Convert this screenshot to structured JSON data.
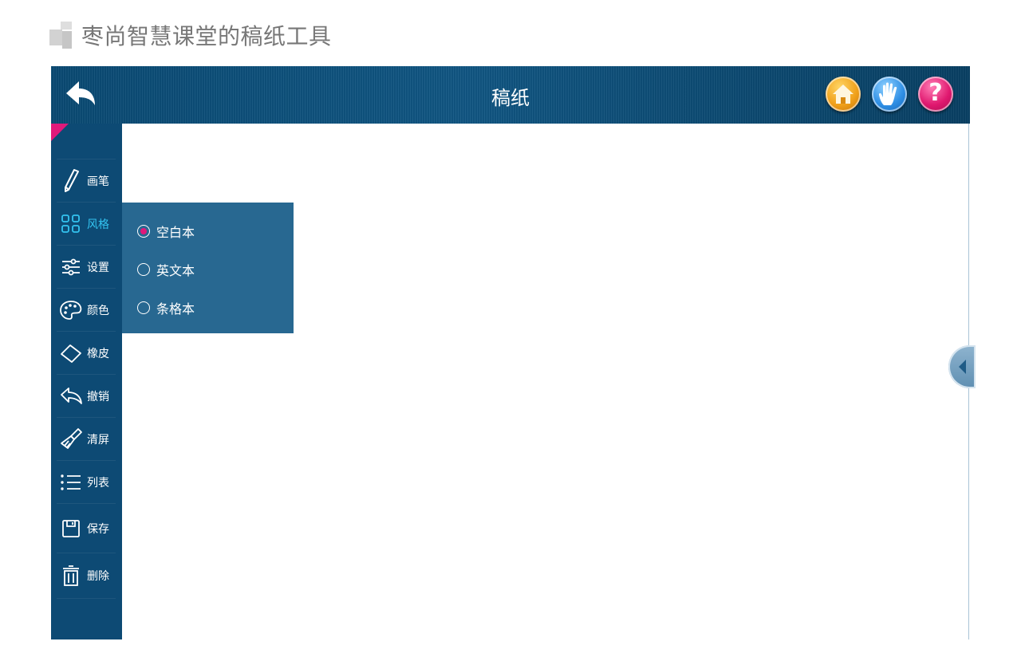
{
  "page": {
    "heading": "枣尚智慧课堂的稿纸工具"
  },
  "topbar": {
    "title": "稿纸",
    "back_icon": "back-arrow-icon",
    "home_icon": "home-icon",
    "hand_icon": "hand-icon",
    "help_icon": "question-mark-icon",
    "help_glyph": "?"
  },
  "sidebar": {
    "items": [
      {
        "label": "画笔",
        "icon": "pen-icon"
      },
      {
        "label": "风格",
        "icon": "grid-icon",
        "active": true
      },
      {
        "label": "设置",
        "icon": "sliders-icon"
      },
      {
        "label": "颜色",
        "icon": "palette-icon"
      },
      {
        "label": "橡皮",
        "icon": "eraser-icon"
      },
      {
        "label": "撤销",
        "icon": "undo-icon"
      },
      {
        "label": "清屏",
        "icon": "brush-icon"
      },
      {
        "label": "列表",
        "icon": "list-icon"
      },
      {
        "label": "保存",
        "icon": "save-icon"
      },
      {
        "label": "删除",
        "icon": "trash-icon"
      }
    ]
  },
  "style_menu": {
    "options": [
      {
        "label": "空白本",
        "selected": true
      },
      {
        "label": "英文本",
        "selected": false
      },
      {
        "label": "条格本",
        "selected": false
      }
    ]
  },
  "colors": {
    "accent": "#e0197a",
    "active": "#33c3f0",
    "sidebar": "#0d4a74",
    "panel": "#286891",
    "topbar": "#0b5280"
  }
}
